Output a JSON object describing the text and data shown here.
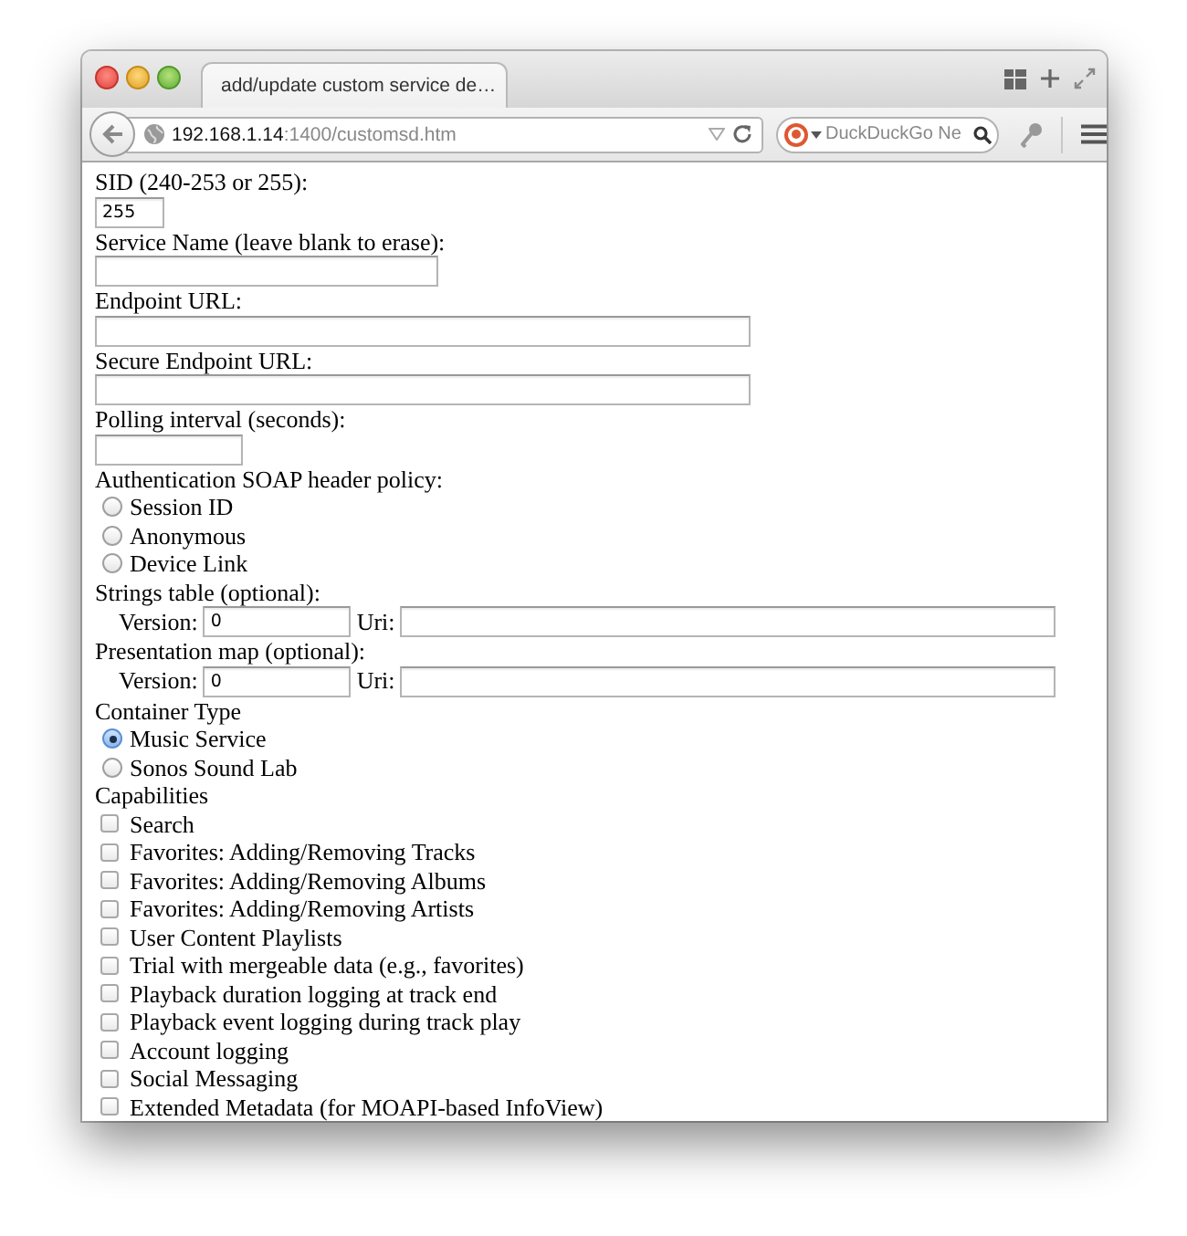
{
  "window": {
    "tab": {
      "title": "add/update custom service de…",
      "selected": true
    },
    "address": {
      "host": "192.168.1.14",
      "path": ":1400/customsd.htm"
    },
    "search": {
      "placeholder": "DuckDuckGo Ne"
    }
  },
  "form": [
    {
      "kind": "text",
      "label": "SID (240-253 or 255):",
      "value": "255"
    },
    {
      "kind": "text",
      "label": "Service Name (leave blank to erase):"
    },
    {
      "kind": "text",
      "label": "Endpoint URL:"
    },
    {
      "kind": "text",
      "label": "Secure Endpoint URL:"
    },
    {
      "kind": "text",
      "label": "Polling interval (seconds):"
    },
    {
      "kind": "radio",
      "label": "Authentication SOAP header policy:",
      "options": [
        {
          "label": "Session ID",
          "selected": false
        },
        {
          "label": "Anonymous",
          "selected": false
        },
        {
          "label": "Device Link",
          "selected": false
        }
      ]
    },
    {
      "kind": "version",
      "label": "Strings table (optional):",
      "version_label": "Version:",
      "version": "0",
      "uri_label": "Uri:"
    },
    {
      "kind": "version",
      "label": "Presentation map (optional):",
      "version_label": "Version:",
      "version": "0",
      "uri_label": "Uri:"
    },
    {
      "kind": "radio",
      "label": "Container Type",
      "options": [
        {
          "label": "Music Service",
          "selected": true
        },
        {
          "label": "Sonos Sound Lab",
          "selected": false
        }
      ]
    },
    {
      "kind": "checkbox",
      "label": "Capabilities",
      "options": [
        {
          "label": "Search",
          "checked": false
        },
        {
          "label": "Favorites: Adding/Removing Tracks",
          "checked": false
        },
        {
          "label": "Favorites: Adding/Removing Albums",
          "checked": false
        },
        {
          "label": "Favorites: Adding/Removing Artists",
          "checked": false
        },
        {
          "label": "User Content Playlists",
          "checked": false
        },
        {
          "label": "Trial with mergeable data (e.g., favorites)",
          "checked": false
        },
        {
          "label": "Playback duration logging at track end",
          "checked": false
        },
        {
          "label": "Playback event logging during track play",
          "checked": false
        },
        {
          "label": "Account logging",
          "checked": false
        },
        {
          "label": "Social Messaging",
          "checked": false
        },
        {
          "label": "Extended Metadata (for MOAPI-based InfoView)",
          "checked": false
        }
      ]
    }
  ]
}
